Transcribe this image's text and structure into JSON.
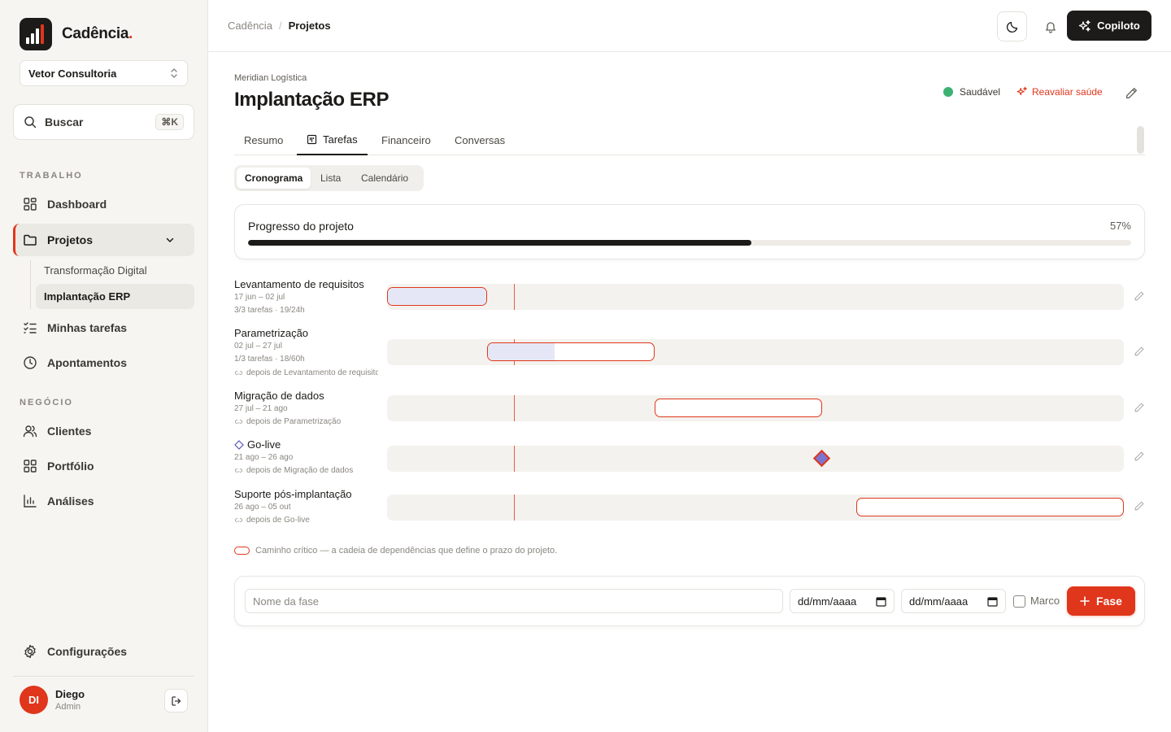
{
  "brand": {
    "name": "Cadência",
    "dot": "."
  },
  "org": {
    "name": "Vetor Consultoria"
  },
  "search": {
    "label": "Buscar",
    "shortcut": "⌘K"
  },
  "sections": {
    "work": "TRABALHO",
    "business": "NEGÓCIO"
  },
  "nav": {
    "dashboard": "Dashboard",
    "projects": "Projetos",
    "project_items": [
      "Transformação Digital",
      "Implantação ERP"
    ],
    "my_tasks": "Minhas tarefas",
    "timesheets": "Apontamentos",
    "clients": "Clientes",
    "portfolio": "Portfólio",
    "analytics": "Análises",
    "settings": "Configurações"
  },
  "user": {
    "initials": "DI",
    "name": "Diego",
    "role": "Admin"
  },
  "breadcrumb": {
    "root": "Cadência",
    "sep": "/",
    "current": "Projetos"
  },
  "header": {
    "copilot": "Copiloto"
  },
  "project": {
    "client": "Meridian Logística",
    "title": "Implantação ERP",
    "health": "Saudável",
    "reassess": "Reavaliar saúde"
  },
  "tabs": [
    "Resumo",
    "Tarefas",
    "Financeiro",
    "Conversas"
  ],
  "views": [
    "Cronograma",
    "Lista",
    "Calendário"
  ],
  "progress": {
    "label": "Progresso do projeto",
    "percent_label": "57%",
    "value": 0.57
  },
  "phases": [
    {
      "name": "Levantamento de requisitos",
      "dates": "17 jun – 02 jul",
      "stats": "3/3 tarefas · 19/24h",
      "dependency": ""
    },
    {
      "name": "Parametrização",
      "dates": "02 jul – 27 jul",
      "stats": "1/3 tarefas · 18/60h",
      "dependency": "depois de Levantamento de requisitos"
    },
    {
      "name": "Migração de dados",
      "dates": "27 jul – 21 ago",
      "stats": "",
      "dependency": "depois de Parametrização"
    },
    {
      "name": "Go-live",
      "dates": "21 ago – 26 ago",
      "stats": "",
      "dependency": "depois de Migração de dados",
      "milestone": true
    },
    {
      "name": "Suporte pós-implantação",
      "dates": "26 ago – 05 out",
      "stats": "",
      "dependency": "depois de Go-live"
    }
  ],
  "legend": "Caminho crítico — a cadeia de dependências que define o prazo do projeto.",
  "add_phase": {
    "placeholder": "Nome da fase",
    "start_date": "dd/mm/aaaa",
    "end_date": "dd/mm/aaaa",
    "milestone_label": "Marco",
    "button": "Fase"
  },
  "colors": {
    "accent": "#e0361b",
    "dark": "#1c1b19",
    "healthy": "#3bb273",
    "milestone": "#7a75d1"
  }
}
